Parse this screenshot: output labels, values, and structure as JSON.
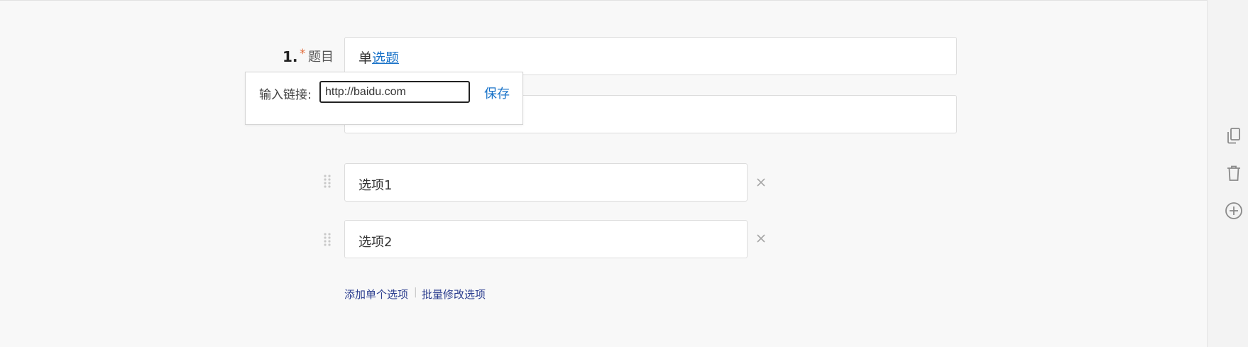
{
  "question": {
    "number": "1.",
    "required_mark": "*",
    "label": "题目",
    "title_plain": "单",
    "title_link": "选题"
  },
  "link_popup": {
    "label": "输入链接:",
    "input_value": "http://baidu.com",
    "save_label": "保存"
  },
  "options": [
    {
      "label": "选项1"
    },
    {
      "label": "选项2"
    }
  ],
  "actions": {
    "add_single": "添加单个选项",
    "separator": "|",
    "batch_edit": "批量修改选项"
  },
  "sidebar_icons": [
    "copy-icon",
    "trash-icon",
    "add-circle-icon"
  ],
  "colors": {
    "link": "#1a73c8",
    "required": "#e26b3a",
    "action_link": "#2c3e8f",
    "background": "#f8f8f8"
  }
}
